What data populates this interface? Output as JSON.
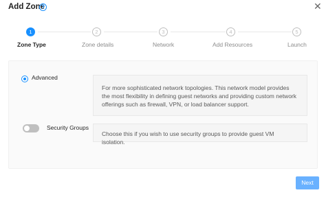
{
  "header": {
    "title": "Add Zone",
    "help_icon": "question-circle-icon",
    "close_icon": "close-icon"
  },
  "steps": [
    {
      "number": "1",
      "label": "Zone Type",
      "active": true
    },
    {
      "number": "2",
      "label": "Zone details",
      "active": false
    },
    {
      "number": "3",
      "label": "Network",
      "active": false
    },
    {
      "number": "4",
      "label": "Add Resources",
      "active": false
    },
    {
      "number": "5",
      "label": "Launch",
      "active": false
    }
  ],
  "options": {
    "advanced": {
      "label": "Advanced",
      "selected": true,
      "description": "For more sophisticated network topologies. This network model provides the most flexibility in defining guest networks and providing custom network offerings such as firewall, VPN, or load balancer support."
    },
    "security_groups": {
      "label": "Security Groups",
      "enabled": false,
      "description": "Choose this if you wish to use security groups to provide guest VM isolation."
    }
  },
  "footer": {
    "next_label": "Next"
  },
  "colors": {
    "accent": "#1890ff",
    "next_button": "#69b1ff"
  }
}
